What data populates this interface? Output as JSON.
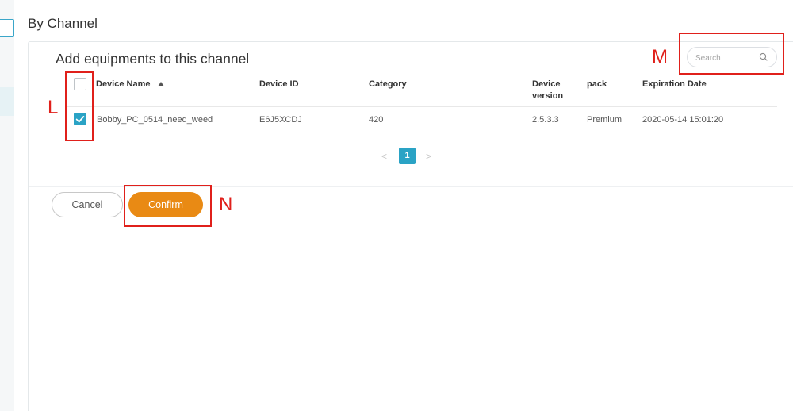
{
  "page": {
    "section_title": "By Channel"
  },
  "dialog": {
    "title": "Add equipments to this channel",
    "search": {
      "placeholder": "Search",
      "value": ""
    },
    "table": {
      "columns": {
        "device_name": "Device Name",
        "device_id": "Device ID",
        "category": "Category",
        "device_version": "Device version",
        "pack": "pack",
        "expiration_date": "Expiration Date"
      },
      "sort": {
        "column": "Device Name",
        "direction": "ascending"
      },
      "rows": [
        {
          "checked": true,
          "device_name": "Bobby_PC_0514_need_weed",
          "device_id": "E6J5XCDJ",
          "category": "420",
          "device_version": "2.5.3.3",
          "pack": "Premium",
          "expiration_date": "2020-05-14 15:01:20"
        }
      ]
    },
    "pagination": {
      "prev": "<",
      "current": "1",
      "next": ">"
    },
    "buttons": {
      "cancel": "Cancel",
      "confirm": "Confirm"
    }
  },
  "annotations": {
    "l": "L",
    "m": "M",
    "n": "N"
  },
  "colors": {
    "accent": "#2aa3c5",
    "confirm": "#e98a14",
    "highlight": "#e0201b"
  },
  "icons": {
    "search": "search-icon",
    "sort": "sort-up-icon",
    "check": "checkmark-icon"
  }
}
